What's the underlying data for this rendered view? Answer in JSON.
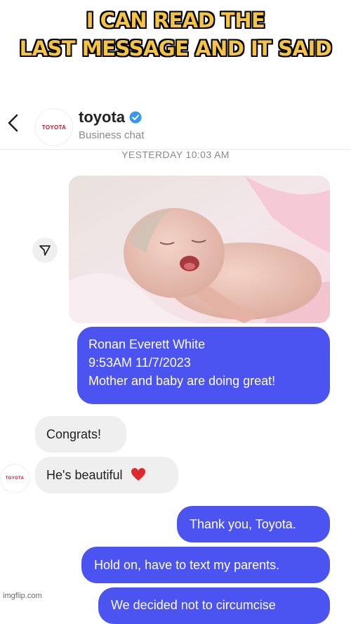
{
  "caption": {
    "line1": "I CAN READ THE",
    "line2": "LAST MESSAGE AND IT SAID"
  },
  "header": {
    "avatar_text": "TOYOTA",
    "name": "toyota",
    "subtitle": "Business chat",
    "back_icon": "chevron-left-icon",
    "verified_icon": "verified-badge-icon"
  },
  "timestamp": "YESTERDAY 10:03 AM",
  "messages": {
    "info_lines": [
      "Ronan Everett White",
      "9:53AM 11/7/2023",
      "Mother and baby are doing great!"
    ],
    "congrats": "Congrats!",
    "beautiful": "He's beautiful",
    "thanks": "Thank you, Toyota.",
    "holdon": "Hold on, have to text my parents.",
    "last_partial": "We decided not to circumcise"
  },
  "watermark": "imgflip.com",
  "colors": {
    "sent_bubble": "#4b54f0",
    "received_bubble": "#efefef",
    "caption_text": "#f6c443",
    "verified": "#3897f0",
    "heart": "#e0292f"
  }
}
